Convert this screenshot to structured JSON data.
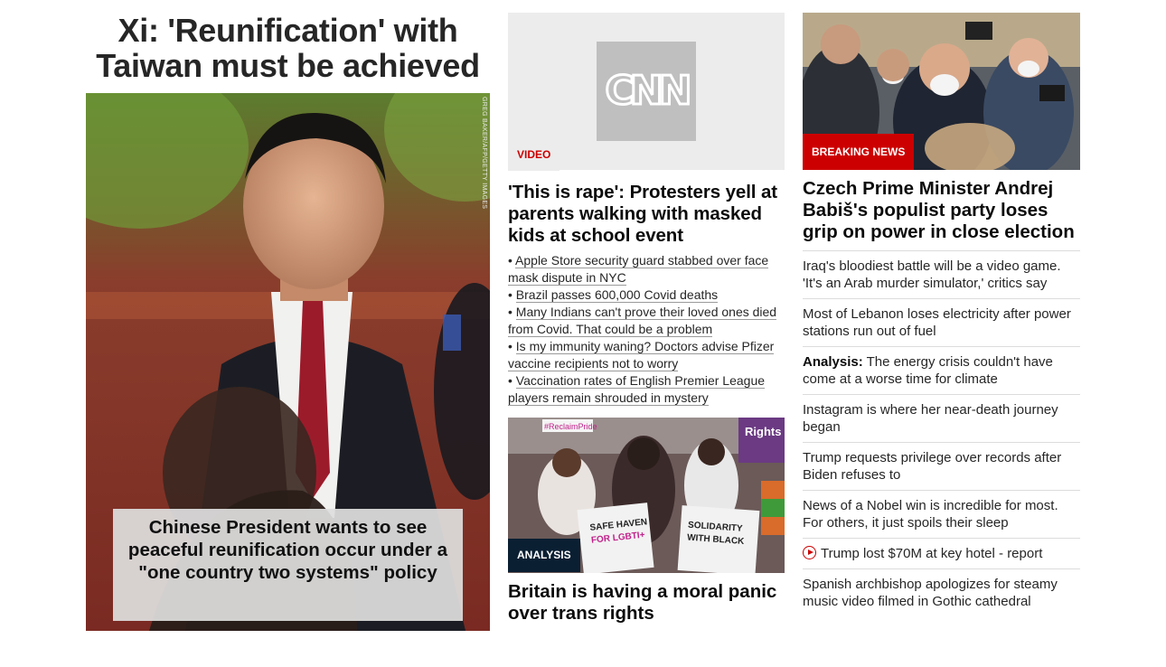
{
  "lead": {
    "title": "Xi: 'Reunification' with Taiwan must be achieved",
    "image_alt": "Chinese President Xi Jinping speaking",
    "image_credit": "GREG BAKER/AFP/GETTY IMAGES",
    "caption": "Chinese President wants to see peaceful reunification occur under a \"one country two systems\" policy"
  },
  "video_story": {
    "logo_text": "CNN",
    "tag": "VIDEO",
    "headline": "'This is rape': Protesters yell at parents walking with masked kids at school event",
    "bullets": [
      "Apple Store security guard stabbed over face mask dispute in NYC",
      "Brazil passes 600,000 Covid deaths",
      "Many Indians can't prove their loved ones died from Covid. That could be a problem",
      "Is my immunity waning? Doctors advise Pfizer vaccine recipients not to worry",
      "Vaccination rates of English Premier League players remain shrouded in mystery"
    ]
  },
  "analysis_story": {
    "tag": "ANALYSIS",
    "headline": "Britain is having a moral panic over trans rights",
    "image_alt": "Protesters holding signs",
    "signs": [
      "#ReclaimPride",
      "SAFE HAVEN FOR LGBTI+ REFUGEES STOP",
      "SOLIDARITY WITH BLACK LIVES MATTER & LGBTI+ POC",
      "Rights Now"
    ]
  },
  "breaking_story": {
    "tag": "BREAKING NEWS",
    "headline": "Czech Prime Minister Andrej Babiš's populist party loses grip on power in close election",
    "image_alt": "Andrej Babis surrounded by reporters"
  },
  "story_list": [
    {
      "prefix": "",
      "text": "Iraq's bloodiest battle will be a video game. 'It's an Arab murder simulator,' critics say",
      "icon": ""
    },
    {
      "prefix": "",
      "text": "Most of Lebanon loses electricity after power stations run out of fuel",
      "icon": ""
    },
    {
      "prefix": "Analysis:",
      "text": " The energy crisis couldn't have come at a worse time for climate",
      "icon": ""
    },
    {
      "prefix": "",
      "text": "Instagram is where her near-death journey began",
      "icon": ""
    },
    {
      "prefix": "",
      "text": "Trump requests privilege over records after Biden refuses to",
      "icon": ""
    },
    {
      "prefix": "",
      "text": "News of a Nobel win is incredible for most. For others, it just spoils their sleep",
      "icon": ""
    },
    {
      "prefix": "",
      "text": "Trump lost $70M at key hotel - report",
      "icon": "play-icon"
    },
    {
      "prefix": "",
      "text": "Spanish archbishop apologizes for steamy music video filmed in Gothic cathedral",
      "icon": ""
    }
  ],
  "colors": {
    "breaking_red": "#cc0000",
    "analysis_navy": "#0b1f33",
    "video_tag_red": "#cc0000"
  }
}
